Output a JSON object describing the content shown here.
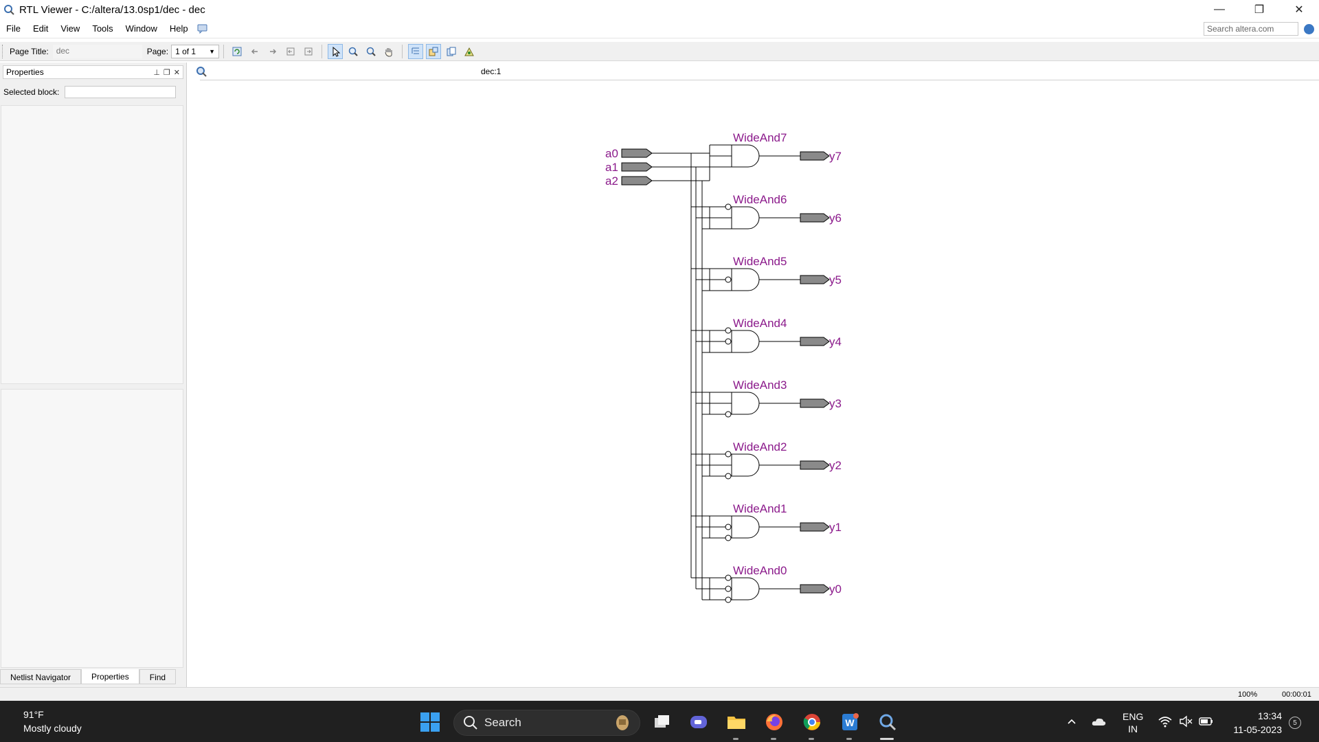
{
  "window": {
    "title": "RTL Viewer - C:/altera/13.0sp1/dec - dec",
    "minimize": "—",
    "maximize": "❐",
    "close": "✕"
  },
  "menu": {
    "items": [
      "File",
      "Edit",
      "View",
      "Tools",
      "Window",
      "Help"
    ],
    "search_placeholder": "Search altera.com"
  },
  "toolbar": {
    "page_title_label": "Page Title:",
    "page_title_value": "dec",
    "page_label": "Page:",
    "page_value": "1 of 1"
  },
  "left_panel": {
    "header": "Properties",
    "selected_block_label": "Selected block:",
    "tabs": [
      "Netlist Navigator",
      "Properties",
      "Find"
    ],
    "active_tab": "Properties"
  },
  "canvas": {
    "tab_label": "dec:1",
    "inputs": [
      "a0",
      "a1",
      "a2"
    ],
    "gates": [
      {
        "name": "WideAnd7",
        "output": "y7",
        "inverted": [
          false,
          false,
          false
        ]
      },
      {
        "name": "WideAnd6",
        "output": "y6",
        "inverted": [
          true,
          false,
          false
        ]
      },
      {
        "name": "WideAnd5",
        "output": "y5",
        "inverted": [
          false,
          true,
          false
        ]
      },
      {
        "name": "WideAnd4",
        "output": "y4",
        "inverted": [
          true,
          true,
          false
        ]
      },
      {
        "name": "WideAnd3",
        "output": "y3",
        "inverted": [
          false,
          false,
          true
        ]
      },
      {
        "name": "WideAnd2",
        "output": "y2",
        "inverted": [
          true,
          false,
          true
        ]
      },
      {
        "name": "WideAnd1",
        "output": "y1",
        "inverted": [
          false,
          true,
          true
        ]
      },
      {
        "name": "WideAnd0",
        "output": "y0",
        "inverted": [
          true,
          true,
          true
        ]
      }
    ],
    "label_color": "#8b1a8b",
    "port_fill": "#8a8a8a"
  },
  "status": {
    "zoom": "100%",
    "elapsed": "00:00:01"
  },
  "taskbar": {
    "temperature": "91°F",
    "weather": "Mostly cloudy",
    "search_label": "Search",
    "language_line1": "ENG",
    "language_line2": "IN",
    "time": "13:34",
    "date": "11-05-2023",
    "notification_count": "5"
  }
}
